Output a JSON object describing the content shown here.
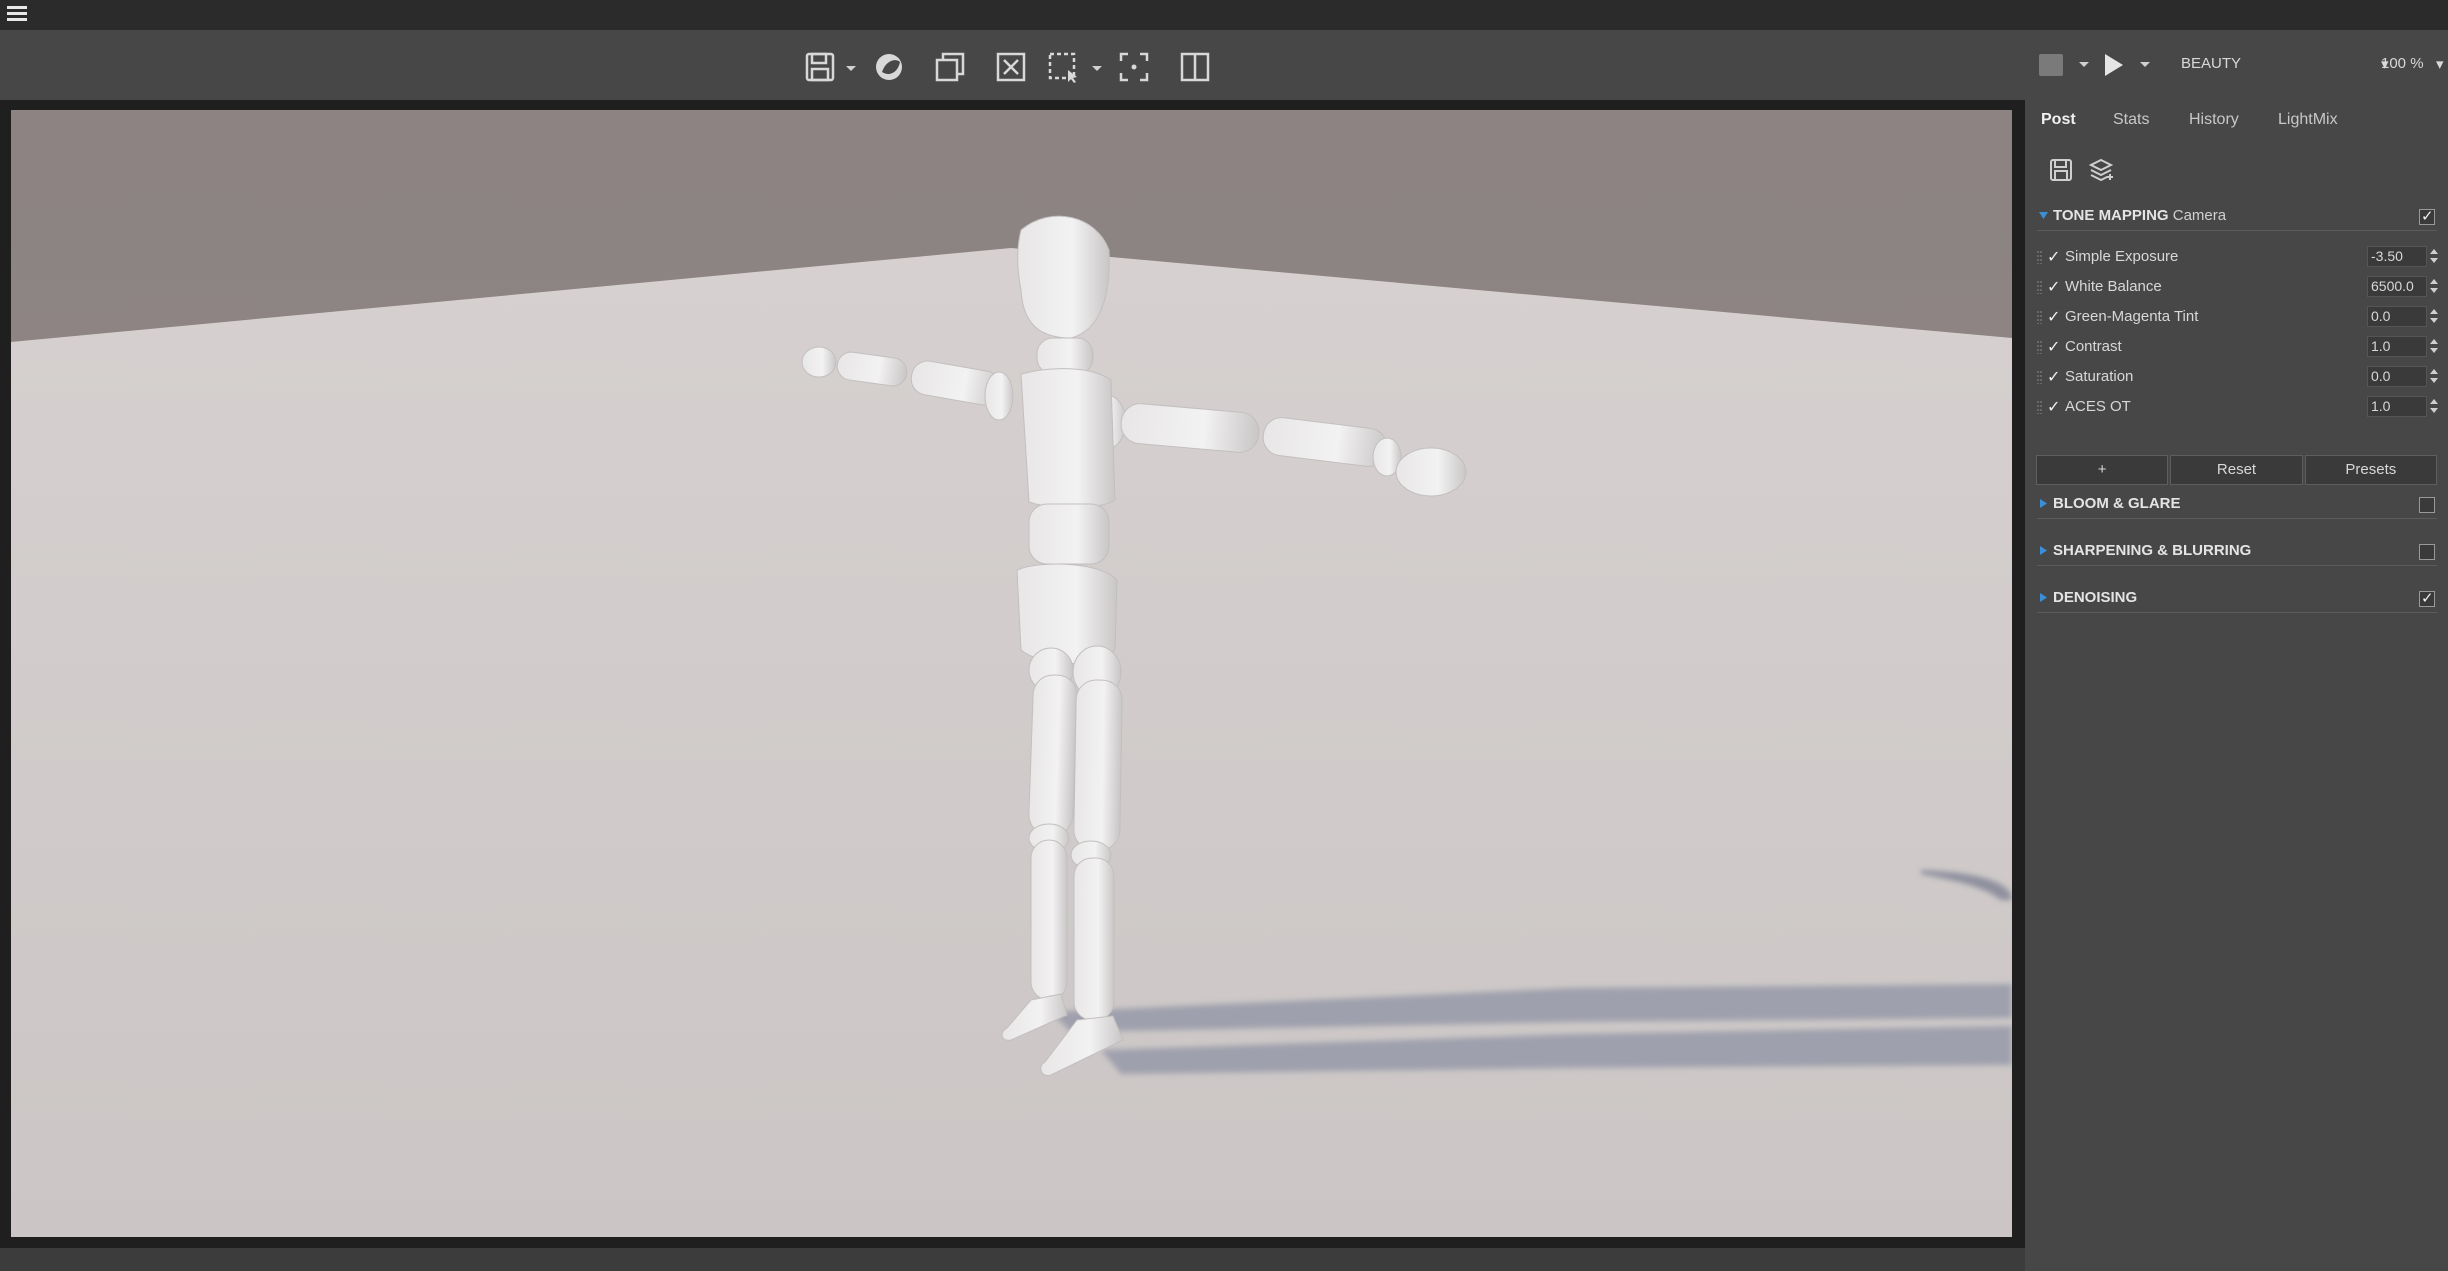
{
  "menubar": {
    "menu_icon": "hamburger-menu-icon"
  },
  "toolbar": {
    "icons": [
      "save-icon",
      "render-sphere-icon",
      "copy-window-icon",
      "clear-icon",
      "region-select-icon",
      "focus-pick-icon",
      "split-view-icon"
    ]
  },
  "render_controls": {
    "pass": "BEAUTY",
    "zoom": "100 %"
  },
  "tabs": [
    "Post",
    "Stats",
    "History",
    "LightMix"
  ],
  "active_tab": "Post",
  "panel_icons": [
    "save-preset-icon",
    "layers-icon"
  ],
  "tone_mapping": {
    "title": "TONE MAPPING",
    "subtitle": "Camera",
    "enabled": true,
    "operators": [
      {
        "label": "Simple Exposure",
        "value": "-3.50",
        "enabled": true
      },
      {
        "label": "White Balance",
        "value": "6500.0",
        "enabled": true
      },
      {
        "label": "Green-Magenta Tint",
        "value": "0.0",
        "enabled": true
      },
      {
        "label": "Contrast",
        "value": "1.0",
        "enabled": true
      },
      {
        "label": "Saturation",
        "value": "0.0",
        "enabled": true
      },
      {
        "label": "ACES OT",
        "value": "1.0",
        "enabled": true
      }
    ],
    "buttons": {
      "add": "+",
      "reset": "Reset",
      "presets": "Presets"
    }
  },
  "sections": [
    {
      "title": "BLOOM & GLARE",
      "enabled": false
    },
    {
      "title": "SHARPENING & BLURRING",
      "enabled": false
    },
    {
      "title": "DENOISING",
      "enabled": true
    }
  ],
  "colors": {
    "accent": "#3a8fd6",
    "background": "#474747",
    "menubar": "#2b2b2b",
    "sky": "#8d8483",
    "floor": "#d2cdcc"
  }
}
